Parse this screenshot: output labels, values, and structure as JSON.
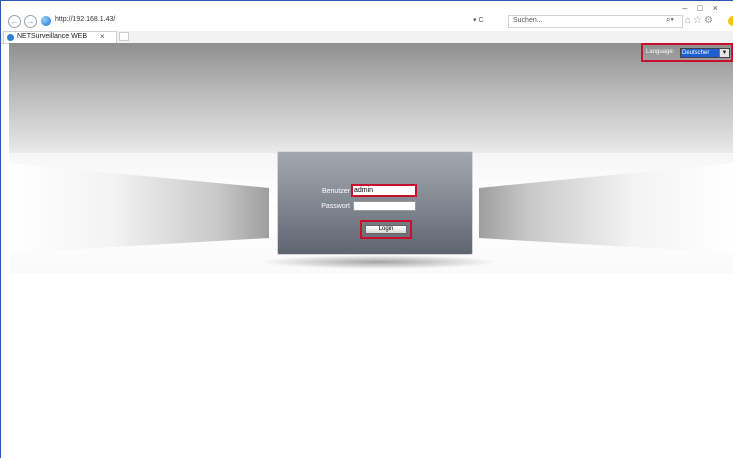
{
  "browser": {
    "url": "http://192.168.1.43/",
    "address_controls": "▾ C",
    "search_placeholder": "Suchen...",
    "tab_title": "NETSurveillance WEB",
    "tab_close": "×",
    "window_controls": "–□×"
  },
  "page": {
    "language": {
      "label": "Language:",
      "selected": "Deutscher"
    },
    "login": {
      "username_label": "Benutzer",
      "username_value": "admin",
      "password_label": "Passwort",
      "password_value": "",
      "login_button": "Login"
    }
  },
  "colors": {
    "highlight": "#c8102e",
    "panel_top": "#a3a8b0",
    "panel_bottom": "#5f656e",
    "select_accent": "#1e5fcf"
  }
}
